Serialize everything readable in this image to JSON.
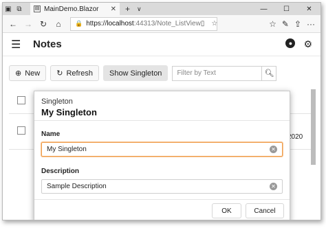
{
  "browser": {
    "tab_title": "MainDemo.Blazor",
    "url_host": "localhost",
    "url_port_path": ":44313/Note_ListView",
    "url_scheme": "https://"
  },
  "app": {
    "title": "Notes"
  },
  "toolbar": {
    "new_label": "New",
    "refresh_label": "Refresh",
    "show_singleton_label": "Show Singleton",
    "filter_placeholder": "Filter by Text"
  },
  "grid": {
    "partial_cell": "2020"
  },
  "modal": {
    "subtitle": "Singleton",
    "title": "My Singleton",
    "name_label": "Name",
    "name_value": "My Singleton",
    "description_label": "Description",
    "description_value": "Sample Description",
    "ok_label": "OK",
    "cancel_label": "Cancel"
  },
  "colors": {
    "focus_border": "#f0a050",
    "hover_button": "#e4e4e4"
  }
}
